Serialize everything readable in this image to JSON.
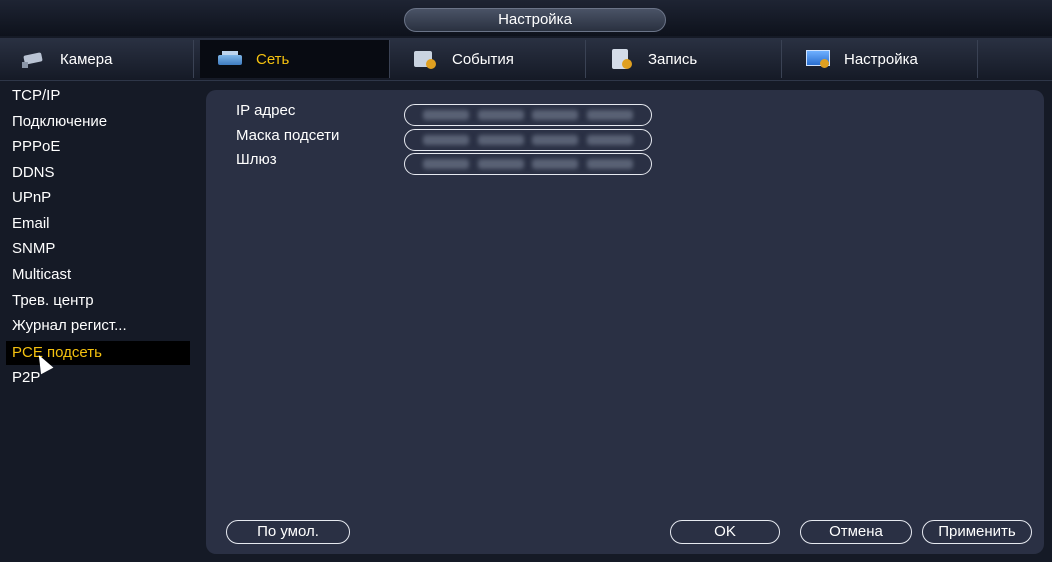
{
  "window": {
    "title": "Настройка"
  },
  "tabs": [
    {
      "label": "Камера",
      "icon": "camera-icon"
    },
    {
      "label": "Сеть",
      "icon": "network-icon",
      "active": true
    },
    {
      "label": "События",
      "icon": "events-icon"
    },
    {
      "label": "Запись",
      "icon": "record-icon"
    },
    {
      "label": "Настройка",
      "icon": "settings-icon"
    }
  ],
  "sidebar": {
    "items": [
      {
        "label": "TCP/IP"
      },
      {
        "label": "Подключение"
      },
      {
        "label": "PPPoE"
      },
      {
        "label": "DDNS"
      },
      {
        "label": "UPnP"
      },
      {
        "label": "Email"
      },
      {
        "label": "SNMP"
      },
      {
        "label": "Multicast"
      },
      {
        "label": "Трев. центр"
      },
      {
        "label": "Журнал регист..."
      },
      {
        "label": "PCE подсеть",
        "active": true
      },
      {
        "label": "P2P"
      }
    ]
  },
  "form": {
    "ip_label": "IP адрес",
    "mask_label": "Маска подсети",
    "gateway_label": "Шлюз"
  },
  "buttons": {
    "default": "По умол.",
    "ok": "OK",
    "cancel": "Отмена",
    "apply": "Применить"
  },
  "colors": {
    "accent": "#f4c10f",
    "panel": "#2a3044",
    "background": "#151a26"
  }
}
